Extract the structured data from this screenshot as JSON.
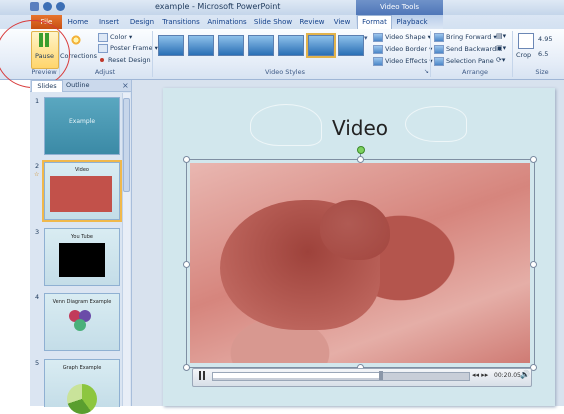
{
  "app": {
    "title": "example - Microsoft PowerPoint",
    "contextual_tab": "Video Tools"
  },
  "tabs": [
    {
      "label": "File"
    },
    {
      "label": "Home"
    },
    {
      "label": "Insert"
    },
    {
      "label": "Design"
    },
    {
      "label": "Transitions"
    },
    {
      "label": "Animations"
    },
    {
      "label": "Slide Show"
    },
    {
      "label": "Review"
    },
    {
      "label": "View"
    },
    {
      "label": "Format"
    },
    {
      "label": "Playback"
    }
  ],
  "ribbon": {
    "preview": {
      "group_label": "Preview",
      "pause_label": "Pause"
    },
    "adjust": {
      "group_label": "Adjust",
      "corrections_label": "Corrections",
      "color_label": "Color",
      "poster_frame_label": "Poster Frame",
      "reset_design_label": "Reset Design"
    },
    "video_styles": {
      "group_label": "Video Styles",
      "styles_count_note": ""
    },
    "video_shape": {
      "shape_label": "Video Shape",
      "border_label": "Video Border",
      "effects_label": "Video Effects"
    },
    "arrange": {
      "group_label": "Arrange",
      "bring_forward_label": "Bring Forward",
      "send_backward_label": "Send Backward",
      "selection_pane_label": "Selection Pane"
    },
    "size": {
      "group_label": "Size",
      "crop_label": "Crop",
      "height_value": "4.95",
      "width_value": "6.5"
    }
  },
  "pane": {
    "slides_tab": "Slides",
    "outline_tab": "Outline",
    "close_glyph": "×",
    "slides": [
      {
        "number": "1",
        "title": "Example"
      },
      {
        "number": "2",
        "title": "Video"
      },
      {
        "number": "3",
        "title": "You Tube"
      },
      {
        "number": "4",
        "title": "Venn Diagram Example"
      },
      {
        "number": "5",
        "title": "Graph Example"
      }
    ]
  },
  "slide": {
    "title": "Video"
  },
  "player": {
    "time": "00:20.05",
    "progress": 0.66
  }
}
